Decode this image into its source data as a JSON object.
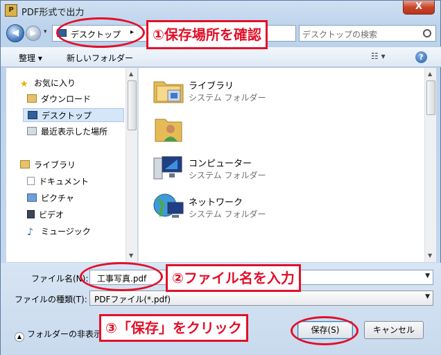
{
  "window": {
    "title": "PDF形式で出力",
    "title_icon": "pdf-app-icon",
    "close_glyph": "X"
  },
  "address": {
    "back_glyph": "◀",
    "forward_glyph": "▶",
    "dropdown_glyph": "▾",
    "location": "デスクトップ",
    "location_arrow": "▸",
    "search_placeholder": "デスクトップの検索"
  },
  "toolbar": {
    "organize_label": "整理 ▾",
    "new_folder_label": "新しいフォルダー",
    "view_glyph": "☷ ▾",
    "help_glyph": "?"
  },
  "sidebar": {
    "favorites_label": "お気に入り",
    "items_favorites": [
      "ダウンロード",
      "デスクトップ",
      "最近表示した場所"
    ],
    "libraries_label": "ライブラリ",
    "items_libraries": [
      "ドキュメント",
      "ピクチャ",
      "ビデオ",
      "ミュージック"
    ]
  },
  "files": [
    {
      "name": "ライブラリ",
      "sub": "システム フォルダー",
      "icon": "library-folder-icon"
    },
    {
      "name": "",
      "sub": "",
      "icon": "user-folder-icon"
    },
    {
      "name": "コンピューター",
      "sub": "システム フォルダー",
      "icon": "computer-icon"
    },
    {
      "name": "ネットワーク",
      "sub": "システム フォルダー",
      "icon": "network-icon"
    }
  ],
  "form": {
    "filename_label": "ファイル名(N):",
    "filename_value": "工事写真.pdf",
    "filetype_label": "ファイルの種類(T):",
    "filetype_value": "PDFファイル(*.pdf)",
    "hide_folders_label": "フォルダーの非表示",
    "save_label": "保存(S)",
    "cancel_label": "キャンセル"
  },
  "annotations": {
    "step1": "①保存場所を確認",
    "step2": "②ファイル名を入力",
    "step3": "③「保存」をクリック"
  },
  "colors": {
    "annotation_red": "#e3102a",
    "selected_bg": "#d5e6f8"
  }
}
